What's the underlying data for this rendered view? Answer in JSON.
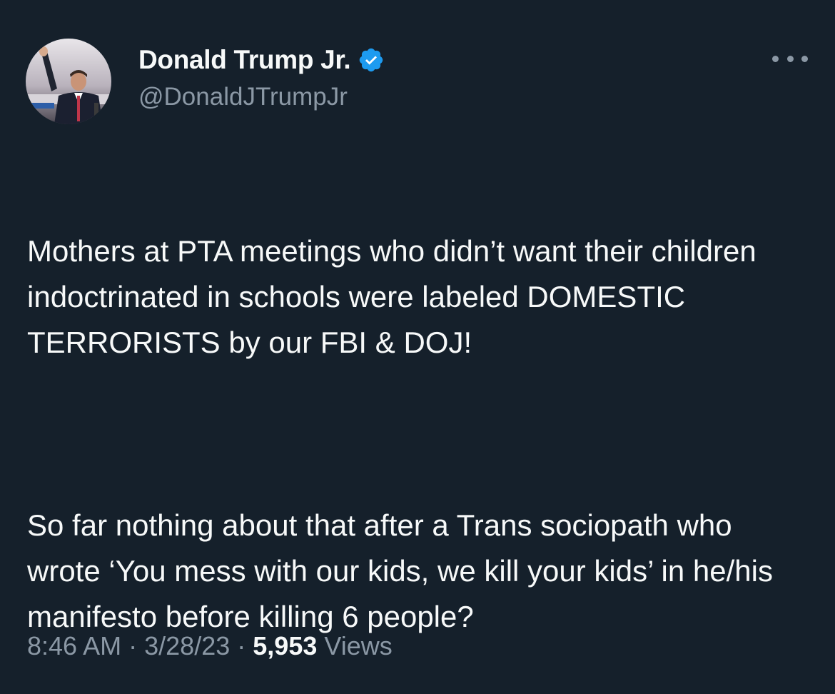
{
  "author": {
    "display_name": "Donald Trump Jr.",
    "handle": "@DonaldJTrumpJr",
    "verified": true,
    "verified_color": "#1d9bf0",
    "avatar_icon": "profile-photo"
  },
  "menu": {
    "icon": "more-horizontal-icon"
  },
  "tweet": {
    "paragraph_1": "Mothers at PTA meetings who didn’t want their children indoctrinated in schools were labeled DOMESTIC TERRORISTS by our FBI & DOJ!",
    "paragraph_2": "So far nothing about that after a Trans sociopath who wrote ‘You mess with our kids, we kill your kids’ in he/his manifesto before killing 6 people?"
  },
  "meta": {
    "time": "8:46 AM",
    "separator": "·",
    "date": "3/28/23",
    "views_count": "5,953",
    "views_label": "Views"
  },
  "colors": {
    "background": "#15202b",
    "primary_text": "#f7f9f9",
    "secondary_text": "#8b98a5"
  }
}
